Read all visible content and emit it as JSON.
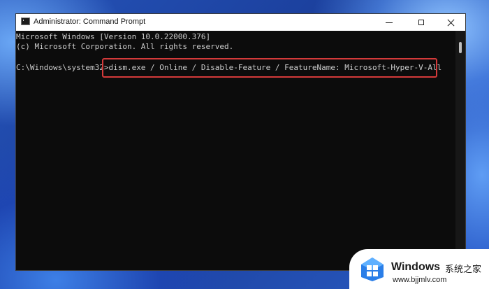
{
  "window": {
    "title": "Administrator: Command Prompt",
    "controls": {
      "minimize_icon": "minimize-icon",
      "maximize_icon": "maximize-icon",
      "close_icon": "close-icon"
    }
  },
  "console": {
    "lines": [
      "Microsoft Windows [Version 10.0.22000.376]",
      "(c) Microsoft Corporation. All rights reserved."
    ],
    "prompt": "C:\\Windows\\system32>",
    "command": "dism.exe / Online / Disable-Feature / FeatureName: Microsoft-Hyper-V-All",
    "highlight_color": "#d43a3a",
    "text_color": "#cccccc",
    "background_color": "#0c0c0c"
  },
  "watermark": {
    "brand": "Windows",
    "brand_cn": "系统之家",
    "url": "www.bjjmlv.com"
  }
}
